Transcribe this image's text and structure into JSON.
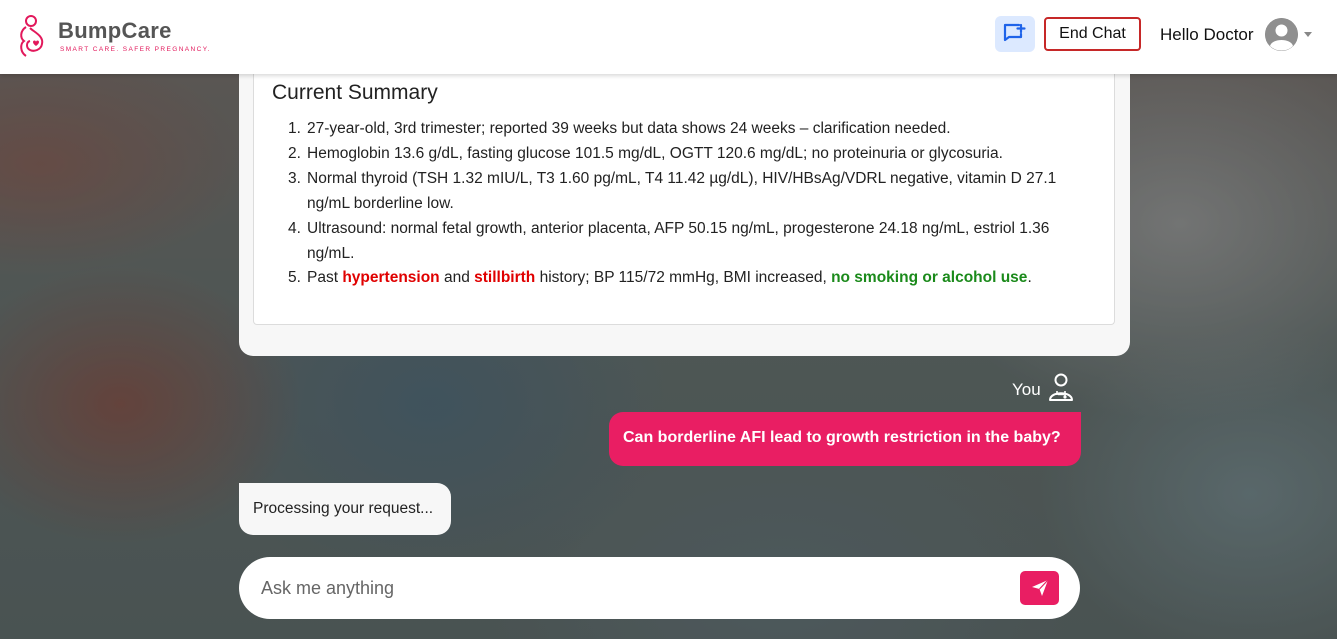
{
  "header": {
    "brand_name": "BumpCare",
    "brand_tagline": "SMART CARE. SAFER PREGNANCY.",
    "end_chat_label": "End Chat",
    "greeting": "Hello Doctor"
  },
  "summary": {
    "title": "Current Summary",
    "items": [
      {
        "num": "1.",
        "parts": [
          {
            "text": "27-year-old, 3rd trimester; reported 39 weeks but data shows 24 weeks – clarification needed.",
            "style": "normal"
          }
        ]
      },
      {
        "num": "2.",
        "parts": [
          {
            "text": "Hemoglobin 13.6 g/dL, fasting glucose 101.5 mg/dL, OGTT 120.6 mg/dL; no proteinuria or glycosuria.",
            "style": "normal"
          }
        ]
      },
      {
        "num": "3.",
        "parts": [
          {
            "text": "Normal thyroid (TSH 1.32 mIU/L, T3 1.60 pg/mL, T4 11.42 µg/dL), HIV/HBsAg/VDRL negative, vitamin D 27.1 ng/mL borderline low.",
            "style": "normal"
          }
        ]
      },
      {
        "num": "4.",
        "parts": [
          {
            "text": "Ultrasound: normal fetal growth, anterior placenta, AFP 50.15 ng/mL, progesterone 24.18 ng/mL, estriol 1.36 ng/mL.",
            "style": "normal"
          }
        ]
      },
      {
        "num": "5.",
        "parts": [
          {
            "text": "Past ",
            "style": "normal"
          },
          {
            "text": "hypertension",
            "style": "red"
          },
          {
            "text": " and ",
            "style": "normal"
          },
          {
            "text": "stillbirth",
            "style": "red"
          },
          {
            "text": " history; BP 115/72 mmHg, BMI increased, ",
            "style": "normal"
          },
          {
            "text": "no smoking or alcohol use",
            "style": "green"
          },
          {
            "text": ".",
            "style": "normal"
          }
        ]
      }
    ]
  },
  "chat": {
    "you_label": "You",
    "user_message": "Can borderline AFI lead to growth restriction in the baby?",
    "bot_message": "Processing your request..."
  },
  "input": {
    "placeholder": "Ask me anything",
    "value": ""
  },
  "colors": {
    "accent": "#e91e63",
    "end_chat_border": "#c62828",
    "highlight_red": "#e00000",
    "highlight_green": "#1b8a1b"
  },
  "icons": {
    "new_chat": "chat-plus-icon",
    "avatar": "user-avatar-icon",
    "dropdown": "caret-down-icon",
    "doctor": "doctor-icon",
    "send": "send-icon",
    "logo": "pregnant-woman-logo-icon"
  }
}
